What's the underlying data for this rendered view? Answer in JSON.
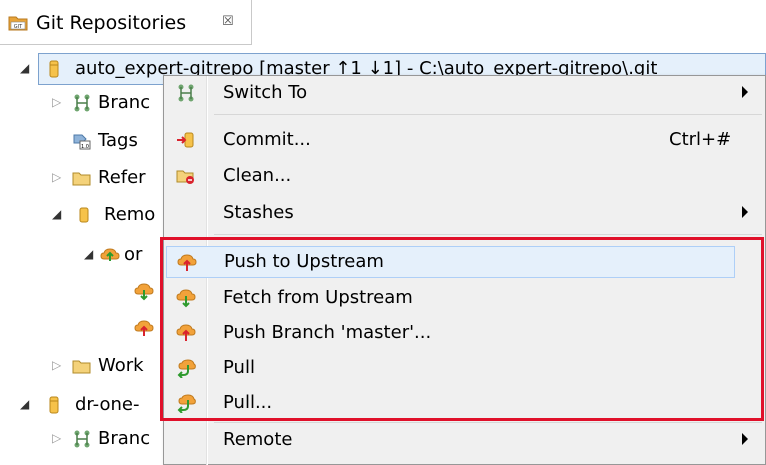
{
  "tab": {
    "title": "Git Repositories",
    "close_glyph": "☒",
    "icon": "git-repo-icon"
  },
  "tree": {
    "rows": [
      {
        "label": "auto_expert-gitrepo [master ↑1 ↓1] - C:\\auto_expert-gitrepo\\.git",
        "icon": "repository-icon",
        "arrow": "expanded"
      },
      {
        "label": "Branc",
        "icon": "branches-icon",
        "arrow": "collapsed"
      },
      {
        "label": "Tags",
        "icon": "tags-icon",
        "arrow": "none"
      },
      {
        "label": "Refer",
        "icon": "folder-icon",
        "arrow": "collapsed"
      },
      {
        "label": "Remo",
        "icon": "remote-icon",
        "arrow": "expanded"
      },
      {
        "label": "or",
        "icon": "remote-origin-icon",
        "arrow": "expanded"
      },
      {
        "label": "",
        "icon": "fetch-icon",
        "arrow": "none"
      },
      {
        "label": "",
        "icon": "push-icon",
        "arrow": "none"
      },
      {
        "label": "Work",
        "icon": "folder-icon",
        "arrow": "collapsed"
      },
      {
        "label": "dr-one-",
        "icon": "repository-icon",
        "arrow": "expanded"
      },
      {
        "label": "Branc",
        "icon": "branches-icon",
        "arrow": "collapsed"
      }
    ]
  },
  "menu": {
    "items": [
      {
        "label": "Switch To",
        "icon": "switch-icon",
        "submenu": true,
        "shortcut": ""
      },
      {
        "label": "Commit...",
        "icon": "commit-icon",
        "submenu": false,
        "shortcut": "Ctrl+#"
      },
      {
        "label": "Clean...",
        "icon": "clean-icon",
        "submenu": false,
        "shortcut": ""
      },
      {
        "label": "Stashes",
        "icon": "",
        "submenu": true,
        "shortcut": ""
      },
      {
        "label": "Push to Upstream",
        "icon": "push-upstream-icon",
        "submenu": false,
        "shortcut": ""
      },
      {
        "label": "Fetch from Upstream",
        "icon": "fetch-upstream-icon",
        "submenu": false,
        "shortcut": ""
      },
      {
        "label": "Push Branch 'master'...",
        "icon": "push-branch-icon",
        "submenu": false,
        "shortcut": ""
      },
      {
        "label": "Pull",
        "icon": "pull-icon",
        "submenu": false,
        "shortcut": ""
      },
      {
        "label": "Pull...",
        "icon": "pull-dialog-icon",
        "submenu": false,
        "shortcut": ""
      },
      {
        "label": "Remote",
        "icon": "",
        "submenu": true,
        "shortcut": ""
      }
    ]
  },
  "colors": {
    "highlight_border": "#e0102a",
    "selection_bg": "#e5f0fb",
    "menu_bg": "#f0f0f0",
    "cloud_orange": "#f2a23a",
    "arrow_red": "#d9232d",
    "arrow_green": "#2e9a2e"
  }
}
